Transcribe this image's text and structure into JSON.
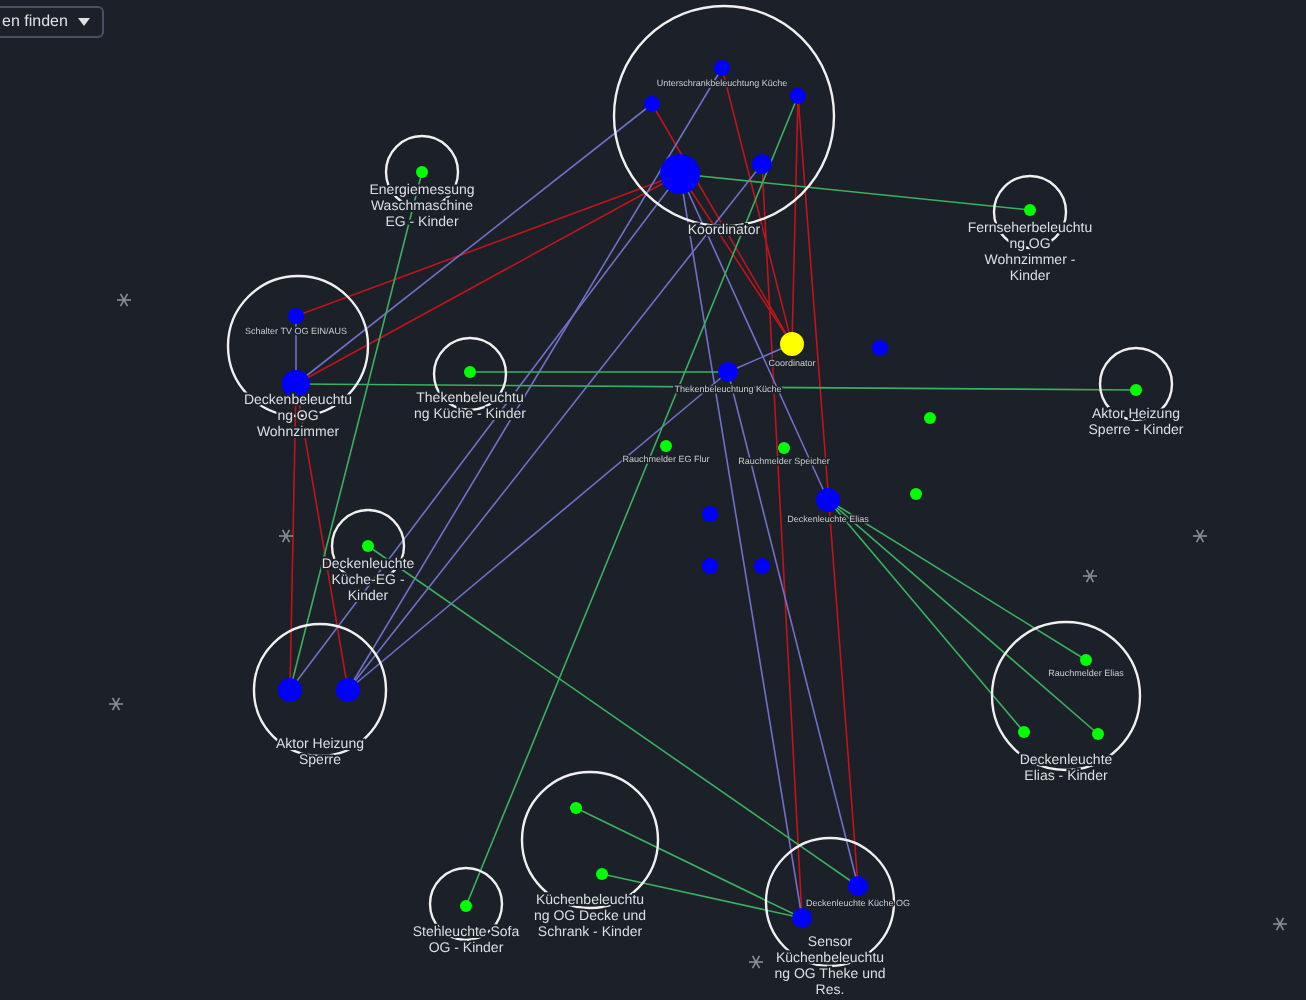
{
  "search_dropdown": {
    "value": "en finden"
  },
  "groups": [
    {
      "label_lines": [
        "Koordinator"
      ],
      "nodes": [
        {
          "kind": "router",
          "label": "Unterschrankbeleuchtung Küche"
        },
        {
          "kind": "router"
        },
        {
          "kind": "router"
        },
        {
          "kind": "router"
        },
        {
          "kind": "router"
        }
      ]
    },
    {
      "label_lines": [
        "Fernseherbeleuchtu",
        "ng OG",
        "Wohnzimmer -",
        "Kinder"
      ],
      "nodes": [
        {
          "kind": "end_device"
        }
      ]
    },
    {
      "label_lines": [
        "Energiemessung",
        "Waschmaschine",
        "EG - Kinder"
      ],
      "nodes": [
        {
          "kind": "end_device"
        }
      ]
    },
    {
      "label_lines": [
        "Deckenbeleuchtu",
        "ng OG",
        "Wohnzimmer"
      ],
      "nodes": [
        {
          "kind": "router",
          "label": "Schalter TV OG EIN/AUS"
        },
        {
          "kind": "router"
        }
      ]
    },
    {
      "label_lines": [
        "Thekenbeleuchtu",
        "ng Küche - Kinder"
      ],
      "nodes": [
        {
          "kind": "end_device"
        }
      ]
    },
    {
      "label_lines": [
        "Deckenleuchte",
        "Küche-EG -",
        "Kinder"
      ],
      "nodes": [
        {
          "kind": "end_device"
        }
      ]
    },
    {
      "label_lines": [
        "Aktor Heizung",
        "Sperre"
      ],
      "nodes": [
        {
          "kind": "router"
        },
        {
          "kind": "router"
        }
      ]
    },
    {
      "label_lines": [
        "Aktor Heizung",
        "Sperre - Kinder"
      ],
      "nodes": [
        {
          "kind": "end_device"
        }
      ]
    },
    {
      "label_lines": [
        "Deckenleuchte",
        "Elias - Kinder"
      ],
      "nodes": [
        {
          "kind": "end_device",
          "label": "Rauchmelder Elias"
        },
        {
          "kind": "end_device"
        },
        {
          "kind": "end_device"
        }
      ]
    },
    {
      "label_lines": [
        "Küchenbeleuchtu",
        "ng OG Decke und",
        "Schrank - Kinder"
      ],
      "nodes": [
        {
          "kind": "end_device"
        },
        {
          "kind": "end_device"
        }
      ]
    },
    {
      "label_lines": [
        "Stehleuchte Sofa",
        "OG - Kinder"
      ],
      "nodes": [
        {
          "kind": "end_device"
        }
      ]
    },
    {
      "label_lines": [
        "Sensor",
        "Küchenbeleuchtu",
        "ng OG Theke und",
        "Res."
      ],
      "nodes": [
        {
          "kind": "router"
        },
        {
          "kind": "router",
          "label": "Deckenleuchte Küche OG"
        }
      ]
    }
  ],
  "free_nodes": [
    {
      "kind": "coordinator",
      "label": "Coordinator"
    },
    {
      "kind": "router",
      "label": "Thekenbeleuchtung Küche"
    },
    {
      "kind": "router"
    },
    {
      "kind": "end_device"
    },
    {
      "kind": "end_device",
      "label": "Rauchmelder EG Flur"
    },
    {
      "kind": "end_device",
      "label": "Rauchmelder Speicher"
    },
    {
      "kind": "router"
    },
    {
      "kind": "router",
      "label": "Deckenleuchte Elias"
    },
    {
      "kind": "end_device"
    },
    {
      "kind": "router"
    },
    {
      "kind": "router"
    }
  ]
}
